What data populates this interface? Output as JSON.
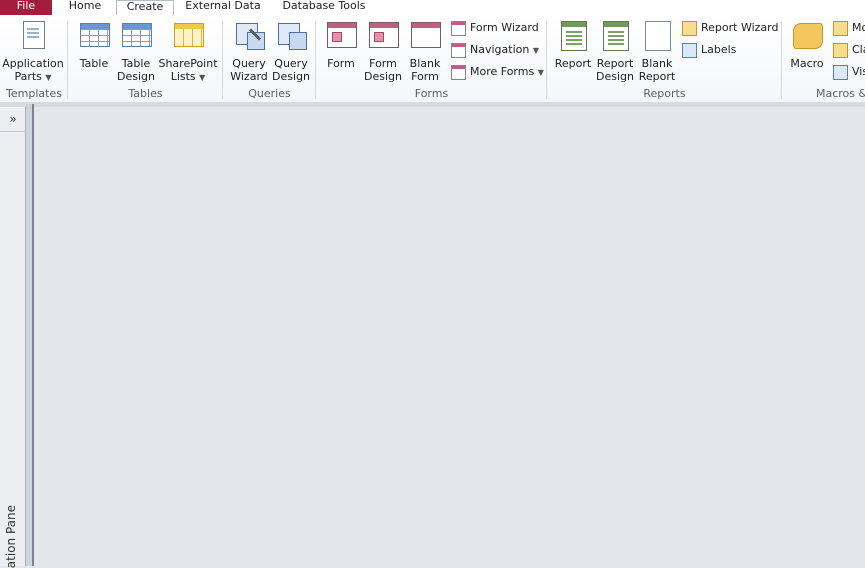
{
  "tabs": [
    {
      "label": "File"
    },
    {
      "label": "Home"
    },
    {
      "label": "Create"
    },
    {
      "label": "External Data"
    },
    {
      "label": "Database Tools"
    }
  ],
  "groups": {
    "templates": {
      "label": "Templates",
      "application_parts": {
        "line1": "Application",
        "line2": "Parts"
      }
    },
    "tables": {
      "label": "Tables",
      "table": {
        "line1": "Table"
      },
      "table_design": {
        "line1": "Table",
        "line2": "Design"
      },
      "sharepoint_lists": {
        "line1": "SharePoint",
        "line2": "Lists"
      }
    },
    "queries": {
      "label": "Queries",
      "query_wizard": {
        "line1": "Query",
        "line2": "Wizard"
      },
      "query_design": {
        "line1": "Query",
        "line2": "Design"
      }
    },
    "forms": {
      "label": "Forms",
      "form": {
        "line1": "Form"
      },
      "form_design": {
        "line1": "Form",
        "line2": "Design"
      },
      "blank_form": {
        "line1": "Blank",
        "line2": "Form"
      },
      "form_wizard": "Form Wizard",
      "navigation": "Navigation",
      "more_forms": "More Forms"
    },
    "reports": {
      "label": "Reports",
      "report": {
        "line1": "Report"
      },
      "report_design": {
        "line1": "Report",
        "line2": "Design"
      },
      "blank_report": {
        "line1": "Blank",
        "line2": "Report"
      },
      "report_wizard": "Report Wizard",
      "labels": "Labels"
    },
    "macros": {
      "label": "Macros &",
      "macro": {
        "line1": "Macro"
      },
      "module": "Mo",
      "class_module": "Cla",
      "visual_basic": "Vis"
    }
  },
  "nav_pane": {
    "toggle": "»",
    "label": "ation Pane"
  },
  "colors": {
    "file_tab": "#a31d3d",
    "workspace": "#e3e6ea"
  }
}
